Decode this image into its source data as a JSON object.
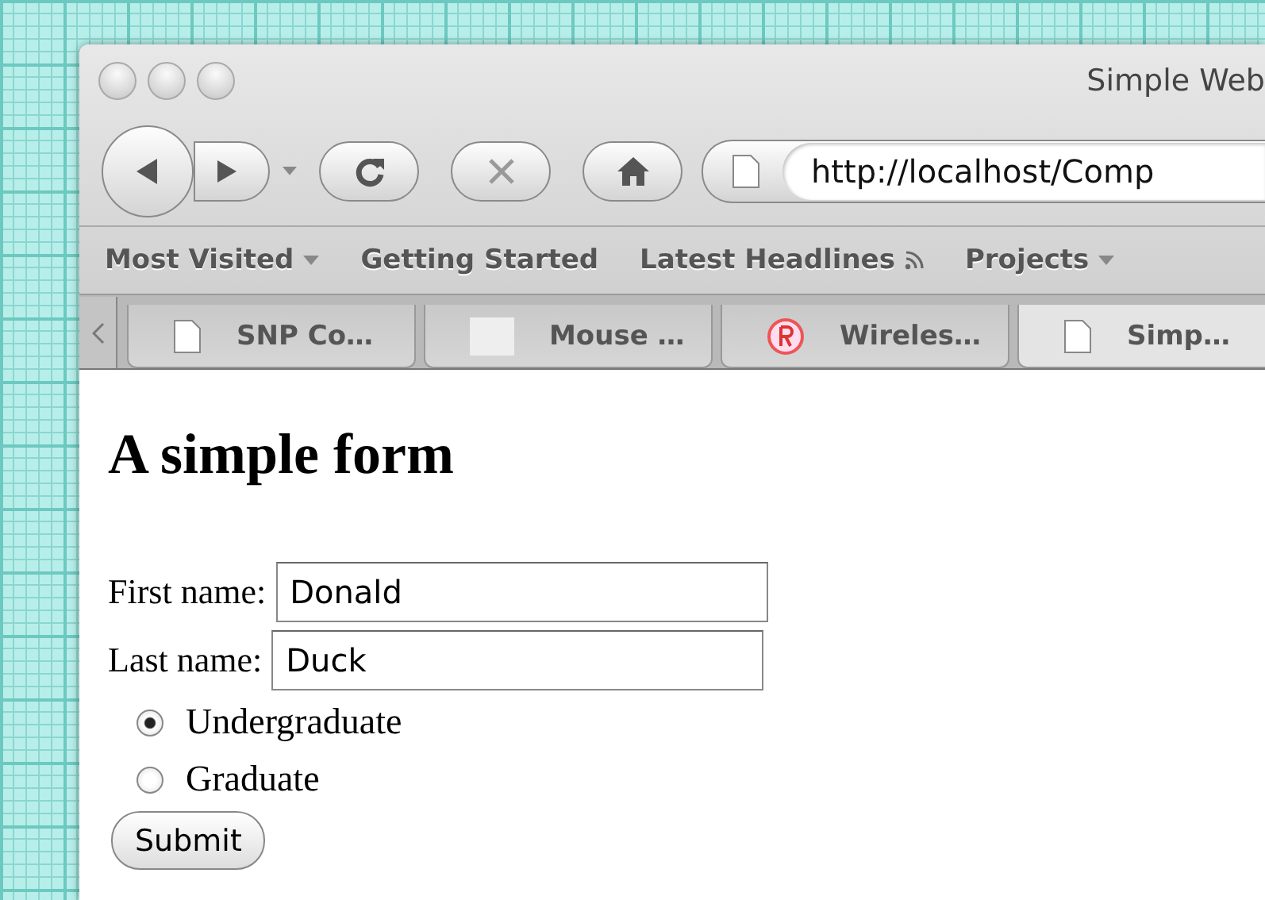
{
  "window": {
    "title": "Simple Web"
  },
  "toolbar": {
    "url": "http://localhost/Comp"
  },
  "bookmarks": [
    {
      "label": "Most Visited",
      "kind": "menu"
    },
    {
      "label": "Getting Started",
      "kind": "link"
    },
    {
      "label": "Latest Headlines",
      "kind": "feed"
    },
    {
      "label": "Projects",
      "kind": "menu"
    }
  ],
  "tabs": [
    {
      "label": "SNP Co…",
      "kind": "page",
      "selected": false
    },
    {
      "label": "Mouse …",
      "kind": "blank",
      "selected": false
    },
    {
      "label": "Wireles…",
      "kind": "logo",
      "selected": false
    },
    {
      "label": "Simp…",
      "kind": "page",
      "selected": true
    }
  ],
  "page": {
    "heading": "A simple form",
    "fields": [
      {
        "label": "First name:",
        "value": "Donald"
      },
      {
        "label": "Last name:",
        "value": "Duck"
      }
    ],
    "radios": [
      {
        "label": "Undergraduate",
        "selected": true
      },
      {
        "label": "Graduate",
        "selected": false
      }
    ],
    "submit": "Submit"
  }
}
